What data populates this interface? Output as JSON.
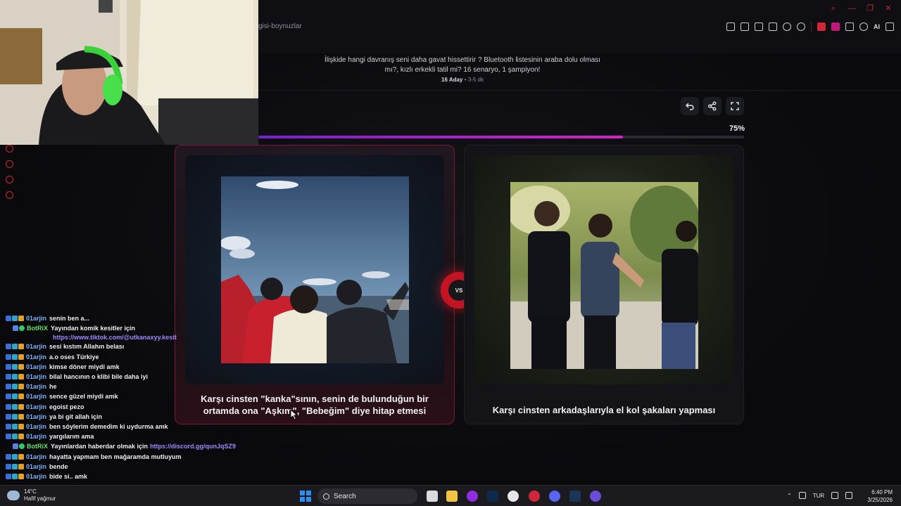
{
  "browser": {
    "url_fragment": "gisi-boynuzlar",
    "ai_label": "AI"
  },
  "quiz": {
    "description": "İlişkide hangi davranış seni daha gavat hissettirir ? Bluetooth listesinin araba dolu olması mı?, kızlı erkekli tatil mi? 16 senaryo, 1 şampiyon!",
    "candidates": "16 Aday",
    "separator": "•",
    "duration": "3-5 dk",
    "progress_percent": 75,
    "progress_label": "75%"
  },
  "cards": {
    "left_label": "Karşı cinsten \"kanka\"sının, senin de bulunduğun bir ortamda ona \"Aşkım\", \"Bebeğim\" diye hitap etmesi",
    "right_label": "Karşı cinsten arkadaşlarıyla el kol şakaları yapması",
    "vs": "VS"
  },
  "chat": [
    {
      "user": "01arjin",
      "msg": "senin ben a...",
      "badges": 3
    },
    {
      "user": "BotRiX",
      "msg": "Yayından komik kesitler için",
      "badges": 2,
      "bot": true
    },
    {
      "link": "https://www.tiktok.com/@utkanaxyy.kesit"
    },
    {
      "user": "01arjin",
      "msg": "sesi kıstım Allahın belası",
      "badges": 3
    },
    {
      "user": "01arjin",
      "msg": "a.o oses Türkiye",
      "badges": 3
    },
    {
      "user": "01arjin",
      "msg": "kimse döner miydi amk",
      "badges": 3
    },
    {
      "user": "01arjin",
      "msg": "bilal hancının o klibi bile daha iyi",
      "badges": 3
    },
    {
      "user": "01arjin",
      "msg": "he",
      "badges": 3
    },
    {
      "user": "01arjin",
      "msg": "sence güzel miydi amk",
      "badges": 3
    },
    {
      "user": "01arjin",
      "msg": "egoist pezo",
      "badges": 3
    },
    {
      "user": "01arjin",
      "msg": "ya bi git allah için",
      "badges": 3
    },
    {
      "user": "01arjin",
      "msg": "ben söylerim demedim ki uydurma amk",
      "badges": 3
    },
    {
      "user": "01arjin",
      "msg": "yargılarım ama",
      "badges": 3
    },
    {
      "user": "BotRiX",
      "msg": "Yayınlardan haberdar olmak için",
      "link": "https://discord.gg/qunJqSZ9",
      "badges": 2,
      "bot": true
    },
    {
      "user": "01arjin",
      "msg": "hayatta yapmam ben mağaramda mutluyum",
      "badges": 3
    },
    {
      "user": "01arjin",
      "msg": "bende",
      "badges": 3
    },
    {
      "user": "01arjin",
      "msg": "bide si.. amk",
      "badges": 3
    }
  ],
  "taskbar": {
    "temperature": "14°C",
    "weather": "Hafif yağmur",
    "search_label": "Search",
    "language": "TUR",
    "time": "6:40 PM",
    "date": "3/25/2026"
  }
}
